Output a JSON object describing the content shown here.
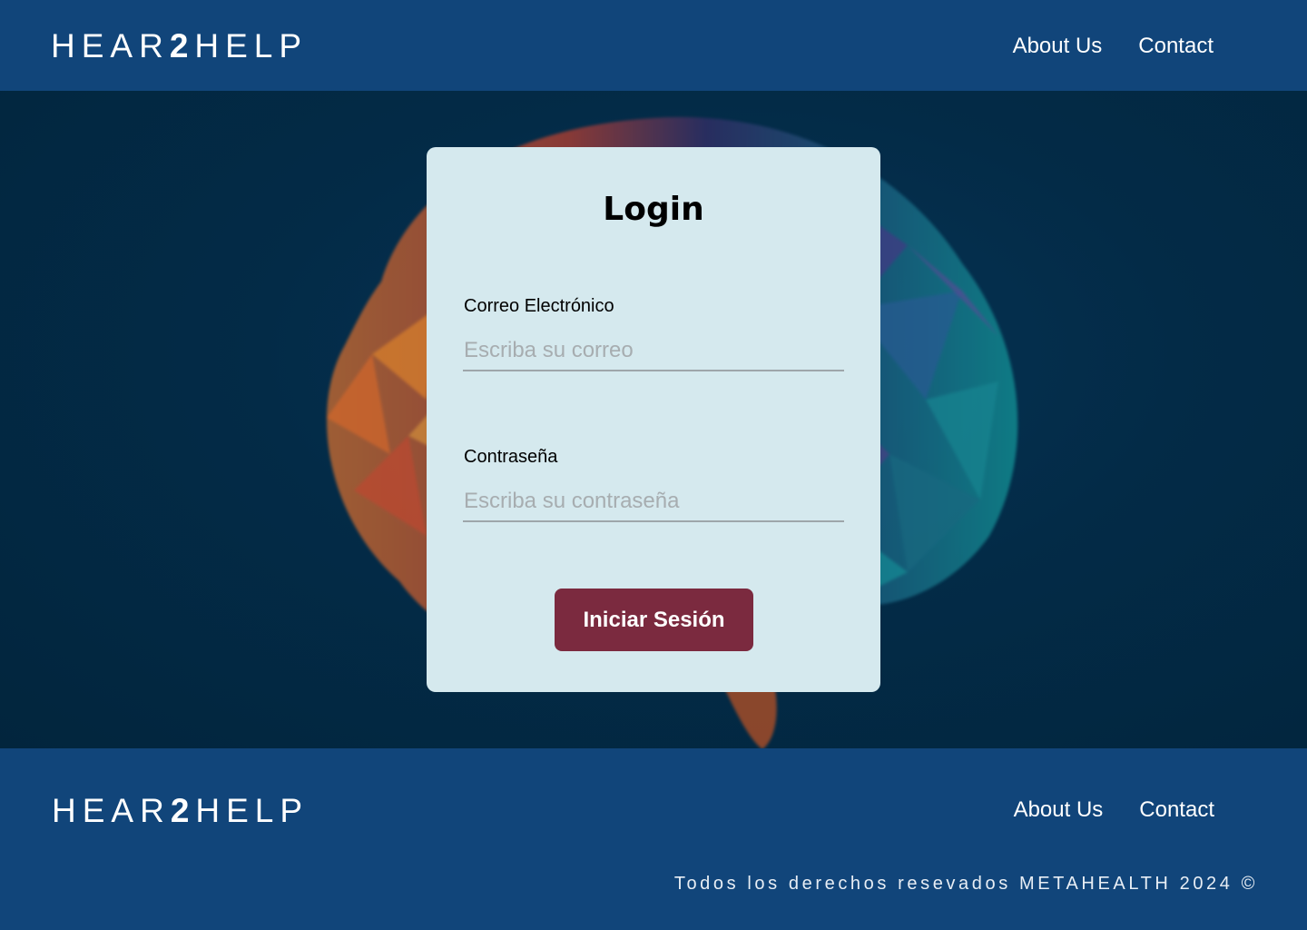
{
  "header": {
    "logo_text_pre": "HEAR",
    "logo_text_bold": "2",
    "logo_text_post": "HELP",
    "nav": {
      "about": "About Us",
      "contact": "Contact"
    }
  },
  "login": {
    "title": "Login",
    "email_label": "Correo Electrónico",
    "email_placeholder": "Escriba su correo",
    "email_value": "",
    "password_label": "Contraseña",
    "password_placeholder": "Escriba su contraseña",
    "password_value": "",
    "submit_label": "Iniciar Sesión"
  },
  "footer": {
    "logo_text_pre": "HEAR",
    "logo_text_bold": "2",
    "logo_text_post": "HELP",
    "nav": {
      "about": "About Us",
      "contact": "Contact"
    },
    "copyright": "Todos los derechos resevados METAHEALTH 2024 ©"
  },
  "colors": {
    "header_bg": "#11457a",
    "hero_bg": "#032b47",
    "card_bg": "#d5e9ee",
    "button_bg": "#7b2a3f"
  },
  "icons": {
    "background_image": "low-poly-brain-illustration"
  }
}
